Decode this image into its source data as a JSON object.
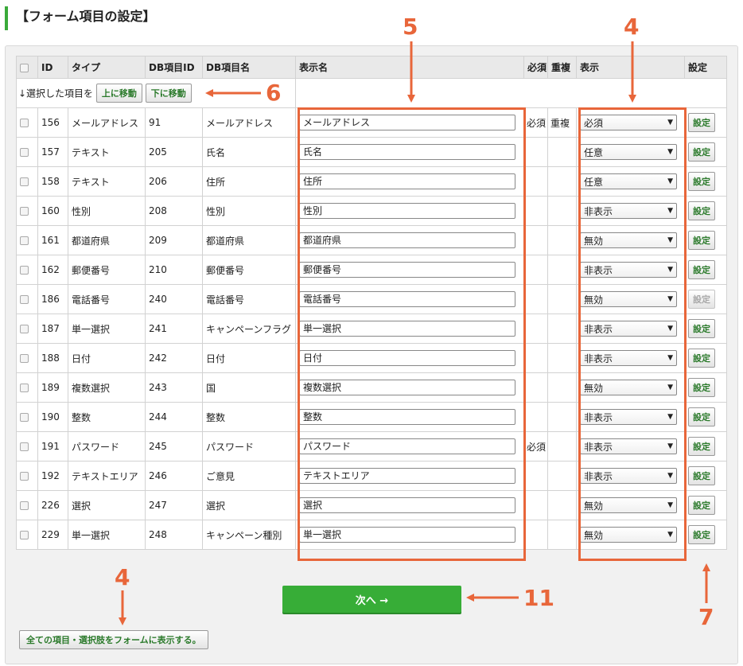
{
  "page": {
    "title": "【フォーム項目の設定】"
  },
  "columns": [
    "",
    "ID",
    "タイプ",
    "DB項目ID",
    "DB項目名",
    "表示名",
    "必須",
    "重複",
    "表示",
    "設定"
  ],
  "move_row": {
    "label": "↓選択した項目を",
    "up_label": "上に移動",
    "down_label": "下に移動"
  },
  "rows": [
    {
      "id": "156",
      "type": "メールアドレス",
      "db_id": "91",
      "db_name": "メールアドレス",
      "display_name": "メールアドレス",
      "required": "必須",
      "duplicate": "重複",
      "visibility": "必須",
      "setting": "設定",
      "setting_disabled": false
    },
    {
      "id": "157",
      "type": "テキスト",
      "db_id": "205",
      "db_name": "氏名",
      "display_name": "氏名",
      "required": "",
      "duplicate": "",
      "visibility": "任意",
      "setting": "設定",
      "setting_disabled": false
    },
    {
      "id": "158",
      "type": "テキスト",
      "db_id": "206",
      "db_name": "住所",
      "display_name": "住所",
      "required": "",
      "duplicate": "",
      "visibility": "任意",
      "setting": "設定",
      "setting_disabled": false
    },
    {
      "id": "160",
      "type": "性別",
      "db_id": "208",
      "db_name": "性別",
      "display_name": "性別",
      "required": "",
      "duplicate": "",
      "visibility": "非表示",
      "setting": "設定",
      "setting_disabled": false
    },
    {
      "id": "161",
      "type": "都道府県",
      "db_id": "209",
      "db_name": "都道府県",
      "display_name": "都道府県",
      "required": "",
      "duplicate": "",
      "visibility": "無効",
      "setting": "設定",
      "setting_disabled": false
    },
    {
      "id": "162",
      "type": "郵便番号",
      "db_id": "210",
      "db_name": "郵便番号",
      "display_name": "郵便番号",
      "required": "",
      "duplicate": "",
      "visibility": "非表示",
      "setting": "設定",
      "setting_disabled": false
    },
    {
      "id": "186",
      "type": "電話番号",
      "db_id": "240",
      "db_name": "電話番号",
      "display_name": "電話番号",
      "required": "",
      "duplicate": "",
      "visibility": "無効",
      "setting": "設定",
      "setting_disabled": true
    },
    {
      "id": "187",
      "type": "単一選択",
      "db_id": "241",
      "db_name": "キャンペーンフラグ",
      "display_name": "単一選択",
      "required": "",
      "duplicate": "",
      "visibility": "非表示",
      "setting": "設定",
      "setting_disabled": false
    },
    {
      "id": "188",
      "type": "日付",
      "db_id": "242",
      "db_name": "日付",
      "display_name": "日付",
      "required": "",
      "duplicate": "",
      "visibility": "非表示",
      "setting": "設定",
      "setting_disabled": false
    },
    {
      "id": "189",
      "type": "複数選択",
      "db_id": "243",
      "db_name": "国",
      "display_name": "複数選択",
      "required": "",
      "duplicate": "",
      "visibility": "無効",
      "setting": "設定",
      "setting_disabled": false
    },
    {
      "id": "190",
      "type": "整数",
      "db_id": "244",
      "db_name": "整数",
      "display_name": "整数",
      "required": "",
      "duplicate": "",
      "visibility": "非表示",
      "setting": "設定",
      "setting_disabled": false
    },
    {
      "id": "191",
      "type": "パスワード",
      "db_id": "245",
      "db_name": "パスワード",
      "display_name": "パスワード",
      "required": "必須",
      "duplicate": "",
      "visibility": "非表示",
      "setting": "設定",
      "setting_disabled": false
    },
    {
      "id": "192",
      "type": "テキストエリア",
      "db_id": "246",
      "db_name": "ご意見",
      "display_name": "テキストエリア",
      "required": "",
      "duplicate": "",
      "visibility": "非表示",
      "setting": "設定",
      "setting_disabled": false
    },
    {
      "id": "226",
      "type": "選択",
      "db_id": "247",
      "db_name": "選択",
      "display_name": "選択",
      "required": "",
      "duplicate": "",
      "visibility": "無効",
      "setting": "設定",
      "setting_disabled": false
    },
    {
      "id": "229",
      "type": "単一選択",
      "db_id": "248",
      "db_name": "キャンペーン種別",
      "display_name": "単一選択",
      "required": "",
      "duplicate": "",
      "visibility": "無効",
      "setting": "設定",
      "setting_disabled": false
    }
  ],
  "buttons": {
    "next": "次へ →",
    "show_all": "全ての項目・選択肢をフォームに表示する。"
  },
  "annotations": {
    "n5": "5",
    "n4_top": "4",
    "n6": "6",
    "n4_bottom": "4",
    "n11": "11",
    "n7": "7"
  },
  "colors": {
    "annotation": "#e8663a",
    "accent": "#37ad37",
    "link_green": "#2b7a2b"
  }
}
